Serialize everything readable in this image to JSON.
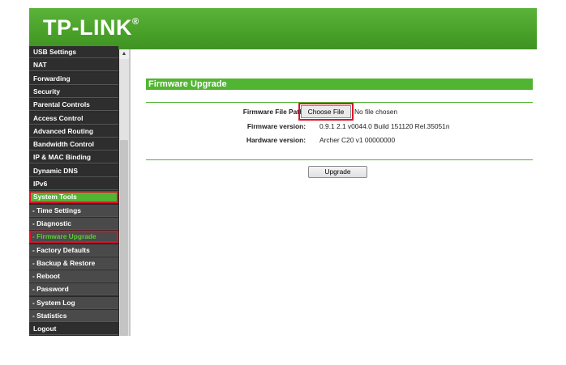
{
  "brand": {
    "logo_text": "TP-LINK",
    "logo_mark": "®"
  },
  "sidebar": {
    "items": [
      {
        "label": "USB Settings",
        "kind": "top"
      },
      {
        "label": "NAT",
        "kind": "top"
      },
      {
        "label": "Forwarding",
        "kind": "top"
      },
      {
        "label": "Security",
        "kind": "top"
      },
      {
        "label": "Parental Controls",
        "kind": "top"
      },
      {
        "label": "Access Control",
        "kind": "top"
      },
      {
        "label": "Advanced Routing",
        "kind": "top"
      },
      {
        "label": "Bandwidth Control",
        "kind": "top"
      },
      {
        "label": "IP & MAC Binding",
        "kind": "top"
      },
      {
        "label": "Dynamic DNS",
        "kind": "top"
      },
      {
        "label": "IPv6",
        "kind": "top"
      },
      {
        "label": "System Tools",
        "kind": "active"
      },
      {
        "label": "- Time Settings",
        "kind": "sub"
      },
      {
        "label": "- Diagnostic",
        "kind": "sub"
      },
      {
        "label": "- Firmware Upgrade",
        "kind": "current"
      },
      {
        "label": "- Factory Defaults",
        "kind": "sub"
      },
      {
        "label": "- Backup & Restore",
        "kind": "sub"
      },
      {
        "label": "- Reboot",
        "kind": "sub"
      },
      {
        "label": "- Password",
        "kind": "sub"
      },
      {
        "label": "- System Log",
        "kind": "sub"
      },
      {
        "label": "- Statistics",
        "kind": "sub"
      },
      {
        "label": "Logout",
        "kind": "top"
      }
    ],
    "scroll_up_glyph": "▲"
  },
  "main": {
    "section_title": "Firmware Upgrade",
    "file_path_label": "Firmware File Path:",
    "choose_file_label": "Choose File",
    "no_file_text": "No file chosen",
    "firmware_version_label": "Firmware version:",
    "firmware_version_value": "0.9.1 2.1 v0044.0 Build 151120 Rel.35051n",
    "hardware_version_label": "Hardware version:",
    "hardware_version_value": "Archer C20 v1 00000000",
    "upgrade_button": "Upgrade"
  },
  "colors": {
    "accent_green": "#52b433",
    "highlight_red": "#e0102a"
  }
}
